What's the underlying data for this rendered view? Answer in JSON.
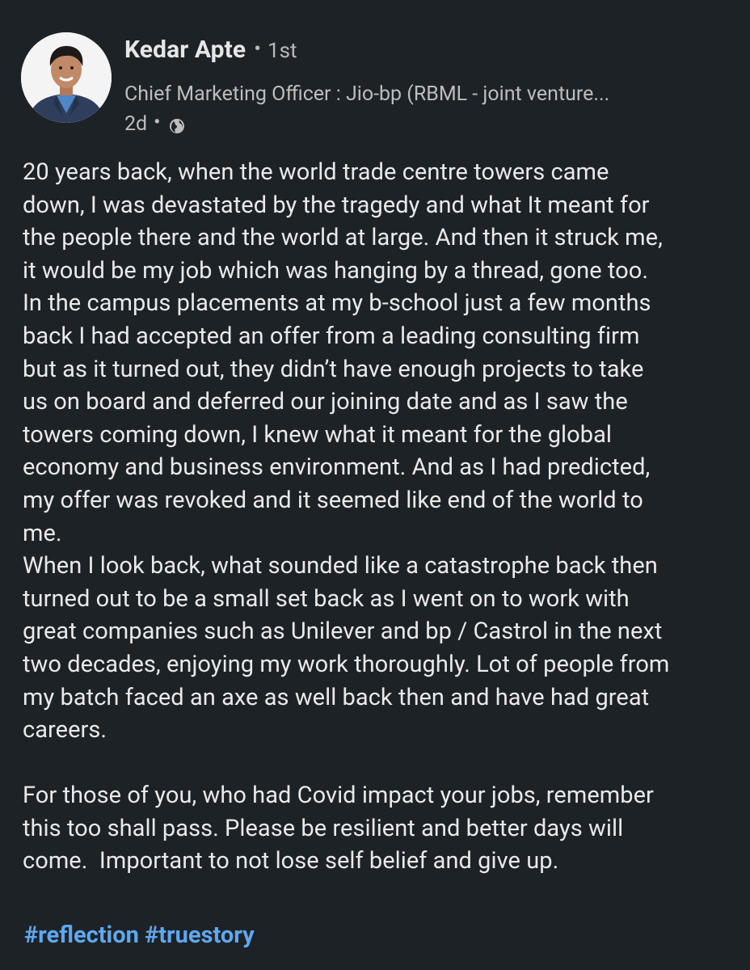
{
  "author": {
    "name": "Kedar Apte",
    "connection_degree": "1st",
    "headline": "Chief Marketing Officer : Jio-bp (RBML - joint venture...",
    "time_ago": "2d",
    "separator": "•",
    "visibility_icon": "globe-icon"
  },
  "post": {
    "body": "20 years back, when the world trade centre towers came\ndown, I was devastated by the tragedy and what It meant for\nthe people there and the world at large. And then it struck me,\nit would be my job which was hanging by a thread, gone too.\nIn the campus placements at my b-school just a few months\nback I had accepted an offer from a leading consulting firm\nbut as it turned out, they didn’t have enough projects to take\nus on board and deferred our joining date and as I saw the\ntowers coming down, I knew what it meant for the global\neconomy and business environment. And as I had predicted,\nmy offer was revoked and it seemed like end of the world to\nme.\nWhen I look back, what sounded like a catastrophe back then\nturned out to be a small set back as I went on to work with\ngreat companies such as Unilever and bp / Castrol in the next\ntwo decades, enjoying my work thoroughly. Lot of people from\nmy batch faced an axe as well back then and have had great\ncareers.\n\nFor those of you, who had Covid impact your jobs, remember\nthis too shall pass. Please be resilient and better days will\ncome.  Important to not lose self belief and give up.",
    "hashtags": [
      "#reflection",
      "#truestory"
    ]
  },
  "colors": {
    "background": "#1d2226",
    "text": "#e9e9ea",
    "muted_text": "#bdbdbd",
    "hashtag": "#5ea8f0"
  }
}
